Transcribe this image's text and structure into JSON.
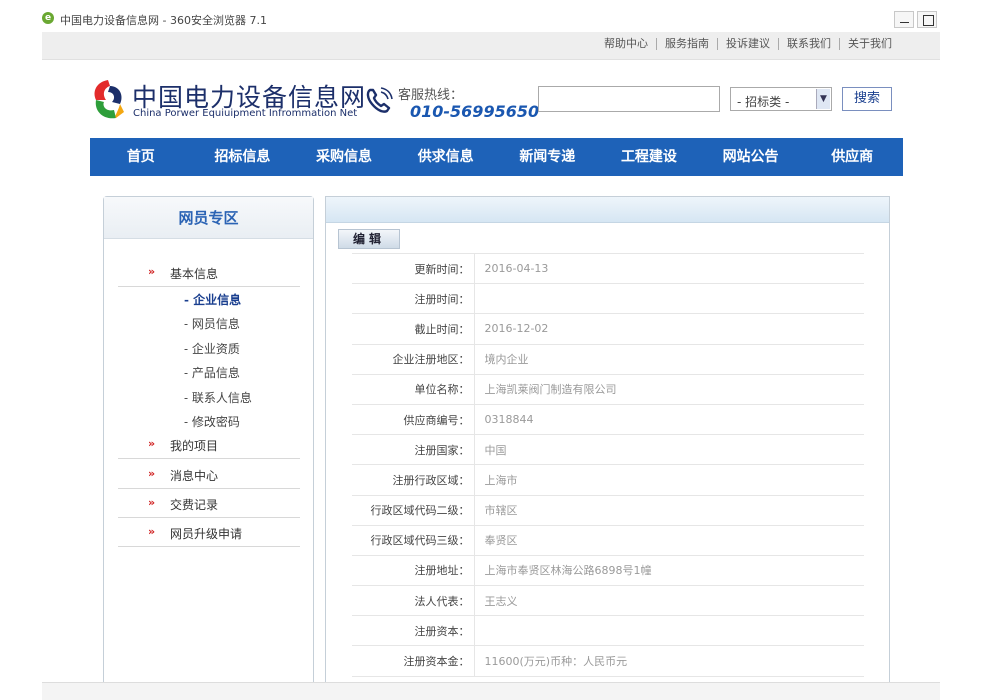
{
  "window": {
    "title": "中国电力设备信息网 - 360安全浏览器 7.1"
  },
  "topbar": {
    "links": [
      "帮助中心",
      "服务指南",
      "投诉建议",
      "联系我们",
      "关于我们"
    ]
  },
  "brand": {
    "name_cn": "中国电力设备信息网",
    "name_en": "China Porwer Equiuipment Infrommation Net"
  },
  "hotline": {
    "label": "客服热线：",
    "number": "010-56995650"
  },
  "search": {
    "input_value": "",
    "category_selected": "- 招标类 -",
    "button_label": "搜索"
  },
  "nav": {
    "items": [
      "首页",
      "招标信息",
      "采购信息",
      "供求信息",
      "新闻专递",
      "工程建设",
      "网站公告",
      "供应商"
    ]
  },
  "sidebar": {
    "title": "网员专区",
    "groups": [
      {
        "label": "基本信息"
      },
      {
        "label": "我的项目"
      },
      {
        "label": "消息中心"
      },
      {
        "label": "交费记录"
      },
      {
        "label": "网员升级申请"
      }
    ],
    "subitems": [
      "- 企业信息",
      "- 网员信息",
      "- 企业资质",
      "- 产品信息",
      "- 联系人信息",
      "- 修改密码"
    ],
    "chevron": "»"
  },
  "panel": {
    "edit_tab": "编辑",
    "rows": [
      {
        "label": "更新时间：",
        "value": "2016-04-13"
      },
      {
        "label": "注册时间：",
        "value": ""
      },
      {
        "label": "截止时间：",
        "value": "2016-12-02"
      },
      {
        "label": "企业注册地区：",
        "value": "境内企业"
      },
      {
        "label": "单位名称：",
        "value": "上海凯莱阀门制造有限公司"
      },
      {
        "label": "供应商编号：",
        "value": "0318844"
      },
      {
        "label": "注册国家：",
        "value": "中国"
      },
      {
        "label": "注册行政区域：",
        "value": "上海市"
      },
      {
        "label": "行政区域代码二级：",
        "value": "市辖区"
      },
      {
        "label": "行政区域代码三级：",
        "value": "奉贤区"
      },
      {
        "label": "注册地址：",
        "value": "上海市奉贤区林海公路6898号1幢"
      },
      {
        "label": "法人代表：",
        "value": "王志义"
      },
      {
        "label": "注册资本：",
        "value": ""
      },
      {
        "label": "注册资本金：",
        "value": "11600(万元)币种：人民币元"
      }
    ]
  },
  "colors": {
    "nav_bg": "#1e62b8",
    "brand_text": "#1c2f6a",
    "hotline_number": "#1a57b0",
    "chevron": "#d02020"
  }
}
